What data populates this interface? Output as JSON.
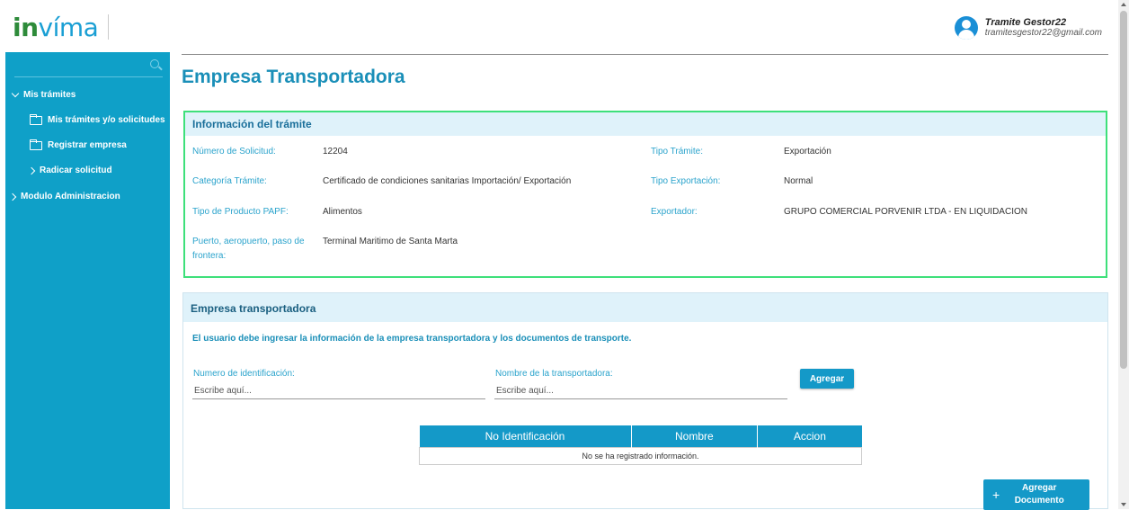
{
  "header": {
    "logo_in": "in",
    "logo_rest": "víma",
    "user_name": "Tramite Gestor22",
    "user_email": "tramitesgestor22@gmail.com"
  },
  "sidebar": {
    "items": [
      {
        "label": "Mis trámites",
        "icon": "chevron-down-icon"
      },
      {
        "label": "Mis trámites y/o solicitudes",
        "icon": "folder-icon"
      },
      {
        "label": "Registrar empresa",
        "icon": "folder-icon"
      },
      {
        "label": "Radicar solicitud",
        "icon": "chevron-right-icon"
      },
      {
        "label": "Modulo Administracion",
        "icon": "chevron-right-icon"
      }
    ]
  },
  "page": {
    "title": "Empresa Transportadora"
  },
  "info_card": {
    "title": "Información del trámite",
    "fields": {
      "numero_label": "Número de Solicitud:",
      "numero_value": "12204",
      "tipo_tramite_label": "Tipo Trámite:",
      "tipo_tramite_value": "Exportación",
      "categoria_label": "Categoría Trámite:",
      "categoria_value": "Certificado de condiciones sanitarias Importación/ Exportación",
      "tipo_exportacion_label": "Tipo Exportación:",
      "tipo_exportacion_value": "Normal",
      "tipo_producto_label": "Tipo de Producto PAPF:",
      "tipo_producto_value": "Alimentos",
      "exportador_label": "Exportador:",
      "exportador_value": "GRUPO COMERCIAL PORVENIR LTDA - EN LIQUIDACION",
      "puerto_label_1": "Puerto, aeropuerto, paso de",
      "puerto_label_2": "frontera:",
      "puerto_value": "Terminal Maritimo de Santa Marta"
    }
  },
  "transport_card": {
    "title": "Empresa transportadora",
    "instructions": "El usuario debe ingresar la información de la empresa transportadora y los documentos de transporte.",
    "id_label": "Numero de identificación:",
    "id_placeholder": "Escribe aquí...",
    "name_label": "Nombre de la transportadora:",
    "name_placeholder": "Escribe aquí...",
    "add_button": "Agregar",
    "table": {
      "headers": [
        "No Identificación",
        "Nombre",
        "Accion"
      ],
      "empty_message": "No se ha registrado información."
    },
    "add_doc_icon": "+",
    "add_doc_line1": "Agregar",
    "add_doc_line2": "Documento"
  },
  "colors": {
    "accent": "#1499c8",
    "sidebar": "#0fa0c8",
    "highlight_border": "#3ee07a"
  }
}
